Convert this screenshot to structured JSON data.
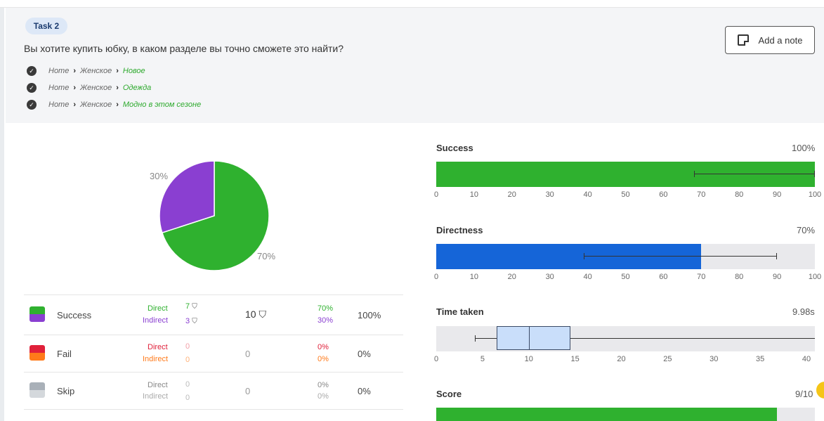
{
  "task": {
    "tag": "Task 2",
    "question": "Вы хотите купить юбку, в каком разделе вы точно сможете это найти?",
    "paths": [
      {
        "crumbs": [
          "Home",
          "Женское"
        ],
        "destination": "Новое"
      },
      {
        "crumbs": [
          "Home",
          "Женское"
        ],
        "destination": "Одежда"
      },
      {
        "crumbs": [
          "Home",
          "Женское"
        ],
        "destination": "Модно в этом сезоне"
      }
    ],
    "add_note_label": "Add a note"
  },
  "pie": {
    "labels": [
      "30%",
      "70%"
    ],
    "slices": [
      {
        "name": "Success direct",
        "value": 70,
        "color": "#2fb12f"
      },
      {
        "name": "Success indirect",
        "value": 30,
        "color": "#8a3fd1"
      }
    ]
  },
  "outcomes": [
    {
      "name": "Success",
      "direct_label": "Direct",
      "indirect_label": "Indirect",
      "direct": "7",
      "indirect": "3",
      "total": "10",
      "direct_pct": "70%",
      "indirect_pct": "30%",
      "overall": "100%",
      "color_top": "#2fb12f",
      "color_bottom": "#8a3fd1",
      "direct_color": "#2fb12f",
      "indirect_color": "#8a3fd1"
    },
    {
      "name": "Fail",
      "direct_label": "Direct",
      "indirect_label": "Indirect",
      "direct": "0",
      "indirect": "0",
      "total": "0",
      "direct_pct": "0%",
      "indirect_pct": "0%",
      "overall": "0%",
      "color_top": "#e0203a",
      "color_bottom": "#ff7a1a",
      "direct_color": "#e0203a",
      "indirect_color": "#ff7a1a"
    },
    {
      "name": "Skip",
      "direct_label": "Direct",
      "indirect_label": "Indirect",
      "direct": "0",
      "indirect": "0",
      "total": "0",
      "direct_pct": "0%",
      "indirect_pct": "0%",
      "overall": "0%",
      "color_top": "#a9b0b8",
      "color_bottom": "#d4d8dc",
      "direct_color": "#888888",
      "indirect_color": "#888888"
    }
  ],
  "panels": {
    "success": {
      "title": "Success",
      "value": "100%",
      "fill": 100,
      "err_low": 68,
      "err_high": 100,
      "color": "#2fb12f",
      "ticks": [
        "0",
        "10",
        "20",
        "30",
        "40",
        "50",
        "60",
        "70",
        "80",
        "90",
        "100"
      ]
    },
    "directness": {
      "title": "Directness",
      "value": "70%",
      "fill": 70,
      "err_low": 39,
      "err_high": 90,
      "color": "#1565d8",
      "ticks": [
        "0",
        "10",
        "20",
        "30",
        "40",
        "50",
        "60",
        "70",
        "80",
        "90",
        "100"
      ]
    },
    "time": {
      "title": "Time taken",
      "value": "9.98s",
      "min": 4.2,
      "q1": 6.5,
      "median": 10,
      "q3": 14.5,
      "max": 41,
      "axis_max": 41,
      "color": "#c9defa",
      "ticks": [
        "0",
        "5",
        "10",
        "15",
        "20",
        "25",
        "30",
        "35",
        "40"
      ]
    },
    "score": {
      "title": "Score",
      "value": "9/10",
      "fill": 90,
      "color": "#2fb12f"
    }
  }
}
